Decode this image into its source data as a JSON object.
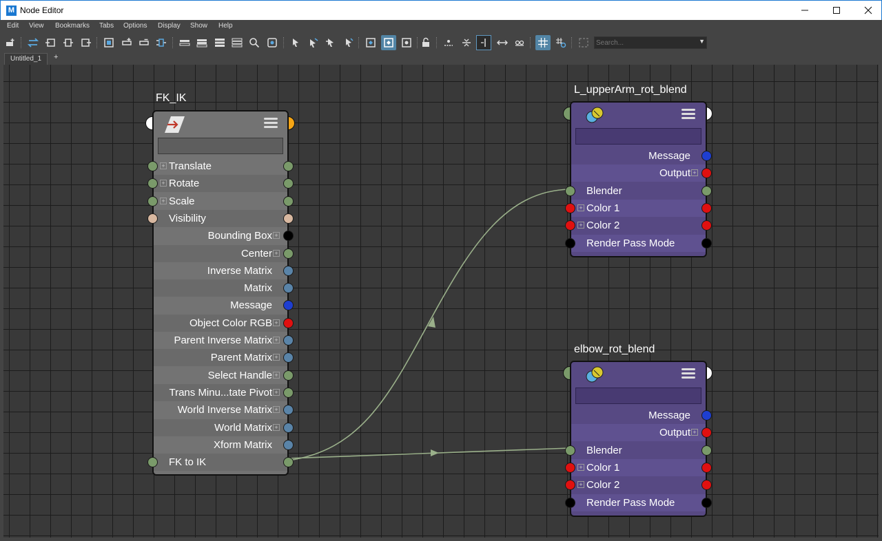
{
  "window": {
    "title": "Node Editor",
    "app_icon": "M"
  },
  "menu": [
    "Edit",
    "View",
    "Bookmarks",
    "Tabs",
    "Options",
    "Display",
    "Show",
    "Help"
  ],
  "toolbar": {
    "search_placeholder": "Search..."
  },
  "tabs": {
    "active": "Untitled_1",
    "add": "+"
  },
  "colors": {
    "accent": "#5285a6",
    "port_green": "#7a9a6a",
    "port_red": "#e01010",
    "port_blue": "#1e3ed0",
    "port_orange": "#f5a515",
    "node_grey": "#737373",
    "node_purple": "#574983"
  },
  "nodes": [
    {
      "title": "FK_IK",
      "attributes": [
        {
          "label": "Translate",
          "align": "left",
          "plus": true,
          "in": "#7a9a6a",
          "out": "#7a9a6a"
        },
        {
          "label": "Rotate",
          "align": "left",
          "plus": true,
          "in": "#7a9a6a",
          "out": "#7a9a6a"
        },
        {
          "label": "Scale",
          "align": "left",
          "plus": true,
          "in": "#7a9a6a",
          "out": "#7a9a6a"
        },
        {
          "label": "Visibility",
          "align": "left",
          "plus": false,
          "in": "#d8b8a0",
          "out": "#d8b8a0"
        },
        {
          "label": "Bounding Box",
          "align": "right",
          "plus": true,
          "in": null,
          "out": "#000000"
        },
        {
          "label": "Center",
          "align": "right",
          "plus": true,
          "in": null,
          "out": "#7a9a6a"
        },
        {
          "label": "Inverse Matrix",
          "align": "right",
          "plus": false,
          "in": null,
          "out": "#5a84a8"
        },
        {
          "label": "Matrix",
          "align": "right",
          "plus": false,
          "in": null,
          "out": "#5a84a8"
        },
        {
          "label": "Message",
          "align": "right",
          "plus": false,
          "in": null,
          "out": "#1e3ed0"
        },
        {
          "label": "Object Color RGB",
          "align": "right",
          "plus": true,
          "in": null,
          "out": "#e01010"
        },
        {
          "label": "Parent Inverse Matrix",
          "align": "right",
          "plus": true,
          "in": null,
          "out": "#5a84a8"
        },
        {
          "label": "Parent Matrix",
          "align": "right",
          "plus": true,
          "in": null,
          "out": "#5a84a8"
        },
        {
          "label": "Select Handle",
          "align": "right",
          "plus": true,
          "in": null,
          "out": "#7a9a6a"
        },
        {
          "label": "Trans Minu...tate Pivot",
          "align": "right",
          "plus": true,
          "in": null,
          "out": "#7a9a6a"
        },
        {
          "label": "World Inverse Matrix",
          "align": "right",
          "plus": true,
          "in": null,
          "out": "#5a84a8"
        },
        {
          "label": "World Matrix",
          "align": "right",
          "plus": true,
          "in": null,
          "out": "#5a84a8"
        },
        {
          "label": "Xform Matrix",
          "align": "right",
          "plus": false,
          "in": null,
          "out": "#5a84a8"
        },
        {
          "label": "FK to IK",
          "align": "left",
          "plus": false,
          "in": "#7a9a6a",
          "out": "#7a9a6a"
        }
      ]
    },
    {
      "title": "L_upperArm_rot_blend",
      "attributes": [
        {
          "label": "Message",
          "align": "right",
          "plus": false,
          "in": null,
          "out": "#1e3ed0"
        },
        {
          "label": "Output",
          "align": "right",
          "plus": true,
          "in": null,
          "out": "#e01010"
        },
        {
          "label": "Blender",
          "align": "left",
          "plus": false,
          "in": "#7a9a6a",
          "out": "#7a9a6a"
        },
        {
          "label": "Color 1",
          "align": "left",
          "plus": true,
          "in": "#e01010",
          "out": "#e01010"
        },
        {
          "label": "Color 2",
          "align": "left",
          "plus": true,
          "in": "#e01010",
          "out": "#e01010"
        },
        {
          "label": "Render Pass Mode",
          "align": "left",
          "plus": false,
          "in": "#000000",
          "out": "#000000"
        }
      ]
    },
    {
      "title": "elbow_rot_blend",
      "attributes": [
        {
          "label": "Message",
          "align": "right",
          "plus": false,
          "in": null,
          "out": "#1e3ed0"
        },
        {
          "label": "Output",
          "align": "right",
          "plus": true,
          "in": null,
          "out": "#e01010"
        },
        {
          "label": "Blender",
          "align": "left",
          "plus": false,
          "in": "#7a9a6a",
          "out": "#7a9a6a"
        },
        {
          "label": "Color 1",
          "align": "left",
          "plus": true,
          "in": "#e01010",
          "out": "#e01010"
        },
        {
          "label": "Color 2",
          "align": "left",
          "plus": true,
          "in": "#e01010",
          "out": "#e01010"
        },
        {
          "label": "Render Pass Mode",
          "align": "left",
          "plus": false,
          "in": "#000000",
          "out": "#000000"
        }
      ]
    }
  ]
}
